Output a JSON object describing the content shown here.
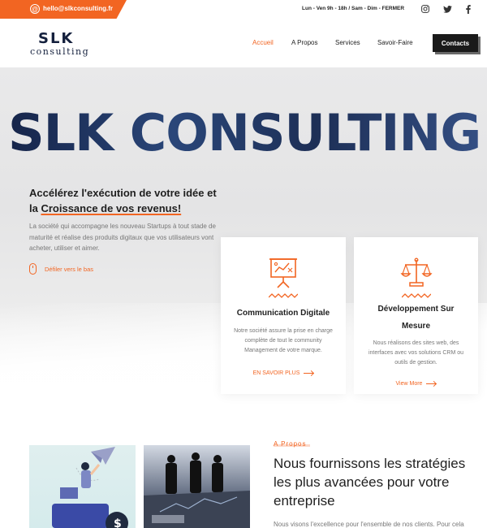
{
  "topbar": {
    "email": "hello@slkconsulting.fr",
    "hours": "Lun - Ven 9h - 18h / Sam - Dim - FERMER",
    "socials": [
      "instagram-icon",
      "twitter-icon",
      "facebook-icon"
    ]
  },
  "header": {
    "logo_main": "SLK",
    "logo_sub": "consulting",
    "nav": [
      "Accueil",
      "A Propos",
      "Services",
      "Savoir-Faire"
    ],
    "active_nav": "Accueil",
    "contact_label": "Contacts"
  },
  "hero": {
    "big_title": "SLK CONSULTING",
    "heading_line1": "Accélérez l'exécution de votre idée et",
    "heading_line2_prefix": "la ",
    "heading_line2_accent": "Croissance de vos revenus!",
    "paragraph": "La société qui accompagne les nouveau Startups à tout stade de maturité et réalise des produits digitaux que vos utilisateurs vont acheter, utiliser et aimer.",
    "scroll_label": "Défiler vers le bas"
  },
  "cards": [
    {
      "icon": "presentation-board-icon",
      "title": "Communication Digitale",
      "body": "Notre société assure la prise en charge complète de tout le community Management de votre marque.",
      "link": "EN SAVOIR PLUS"
    },
    {
      "icon": "scales-icon",
      "title": "Développement Sur Mesure",
      "body": "Nous réalisons des sites web, des interfaces avec vos solutions CRM ou outils de gestion.",
      "link": "View More"
    }
  ],
  "about": {
    "kicker": "A Propos",
    "title": "Nous fournissons les stratégies les plus avancées pour votre entreprise",
    "paragraph": "Nous visons l'excellence pour l'ensemble de nos clients. Pour cela"
  },
  "colors": {
    "accent": "#f26522",
    "dark": "#1a1a1a",
    "navy": "#1d2f56"
  }
}
